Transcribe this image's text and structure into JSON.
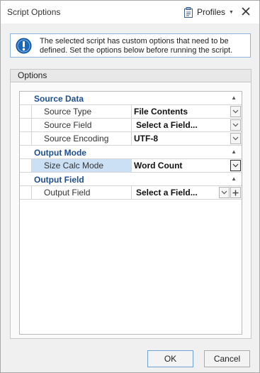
{
  "window": {
    "title": "Script Options"
  },
  "toolbar": {
    "profiles_label": "Profiles",
    "profiles_icon": "clipboard-icon",
    "close_icon": "close-icon"
  },
  "info": {
    "icon": "info-icon",
    "text": "The selected script has custom options that need to be defined. Set the options below before running the script."
  },
  "options_group": {
    "title": "Options"
  },
  "property_grid": {
    "categories": [
      {
        "label": "Source Data",
        "rows": [
          {
            "name": "Source Type",
            "value": "File Contents"
          },
          {
            "name": "Source Field",
            "value": "Select a Field..."
          },
          {
            "name": "Source Encoding",
            "value": "UTF-8"
          }
        ]
      },
      {
        "label": "Output Mode",
        "rows": [
          {
            "name": "Size Calc Mode",
            "value": "Word Count",
            "selected": true
          }
        ]
      },
      {
        "label": "Output Field",
        "rows": [
          {
            "name": "Output Field",
            "value": "Select a Field..."
          }
        ]
      }
    ]
  },
  "buttons": {
    "ok": "OK",
    "cancel": "Cancel"
  },
  "colors": {
    "category_text": "#1f4e8f",
    "selected_row": "#cce0f5",
    "info_icon": "#1a66b8"
  }
}
